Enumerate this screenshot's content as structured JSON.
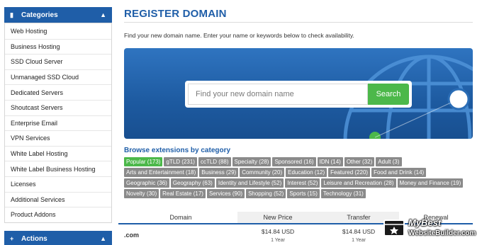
{
  "sidebar": {
    "categories_title": "Categories",
    "items": [
      {
        "label": "Web Hosting"
      },
      {
        "label": "Business Hosting"
      },
      {
        "label": "SSD Cloud Server"
      },
      {
        "label": "Unmanaged SSD Cloud"
      },
      {
        "label": "Dedicated Servers"
      },
      {
        "label": "Shoutcast Servers"
      },
      {
        "label": "Enterprise Email"
      },
      {
        "label": "VPN Services"
      },
      {
        "label": "White Label Hosting"
      },
      {
        "label": "White Label Business Hosting"
      },
      {
        "label": "Licenses"
      },
      {
        "label": "Additional Services"
      },
      {
        "label": "Product Addons"
      }
    ],
    "actions_title": "Actions"
  },
  "main": {
    "title": "REGISTER DOMAIN",
    "intro": "Find your new domain name. Enter your name or keywords below to check availability.",
    "search": {
      "placeholder": "Find your new domain name",
      "button": "Search"
    },
    "browse_title": "Browse extensions by category",
    "tags": [
      {
        "label": "Popular (173)",
        "active": true
      },
      {
        "label": "gTLD (231)"
      },
      {
        "label": "ccTLD (88)"
      },
      {
        "label": "Specialty (28)"
      },
      {
        "label": "Sponsored (16)"
      },
      {
        "label": "IDN (14)"
      },
      {
        "label": "Other (32)"
      },
      {
        "label": "Adult (3)"
      },
      {
        "label": "Arts and Entertainment (18)"
      },
      {
        "label": "Business (29)"
      },
      {
        "label": "Community (20)"
      },
      {
        "label": "Education (12)"
      },
      {
        "label": "Featured (220)"
      },
      {
        "label": "Food and Drink (14)"
      },
      {
        "label": "Geographic (36)"
      },
      {
        "label": "Geography (63)"
      },
      {
        "label": "Identity and Lifestyle (52)"
      },
      {
        "label": "Interest (52)"
      },
      {
        "label": "Leisure and Recreation (28)"
      },
      {
        "label": "Money and Finance (19)"
      },
      {
        "label": "Novelty (30)"
      },
      {
        "label": "Real Estate (17)"
      },
      {
        "label": "Services (90)"
      },
      {
        "label": "Shopping (52)"
      },
      {
        "label": "Sports (15)"
      },
      {
        "label": "Technology (31)"
      }
    ],
    "table": {
      "headers": {
        "domain": "Domain",
        "new_price": "New Price",
        "transfer": "Transfer",
        "renewal": "Renewal"
      },
      "rows": [
        {
          "domain": ".com",
          "new_price": "$14.84 USD",
          "new_period": "1 Year",
          "transfer": "$14.84 USD",
          "transfer_period": "1 Year"
        }
      ]
    }
  },
  "watermark": {
    "line1": "MyBest",
    "line2": "WebsiteBuilder.com"
  },
  "colors": {
    "brand_blue": "#1f5ea8",
    "active_green": "#4cb84a",
    "tag_gray": "#8a8a8a"
  }
}
